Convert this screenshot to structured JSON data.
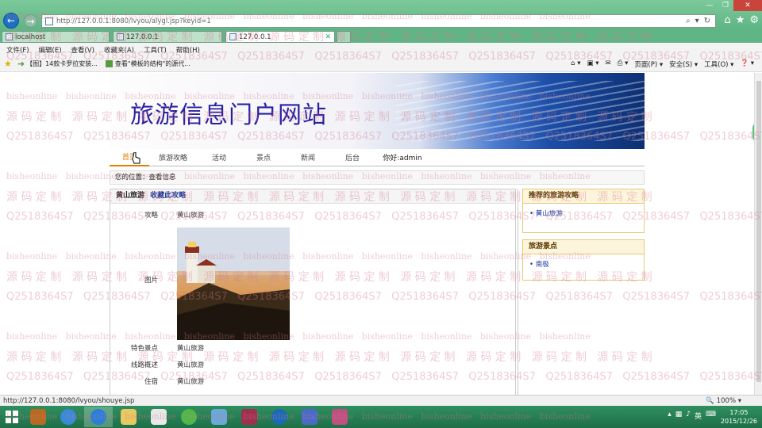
{
  "browser": {
    "address_url": "http://127.0.0.1:8080/lvyou/alygl.jsp?keyid=1",
    "tabs": [
      {
        "label": "localhost"
      },
      {
        "label": "127.0.0.1"
      },
      {
        "label": "127.0.0.1"
      }
    ],
    "menu": [
      "文件(F)",
      "编辑(E)",
      "查看(V)",
      "收藏夹(A)",
      "工具(T)",
      "帮助(H)"
    ],
    "favorites": [
      {
        "label": "【图】14款卡罗拉安装..."
      },
      {
        "label": "查看\"模板的结构\"的源代..."
      }
    ],
    "commands": [
      "页面(P) ▾",
      "安全(S) ▾",
      "工具(O) ▾",
      "❓ ▾"
    ],
    "status_url": "http://127.0.0.1:8080/lvyou/shouye.jsp",
    "zoom": "100%"
  },
  "site": {
    "banner_title": "旅游信息门户网站",
    "nav": [
      {
        "label": "首页"
      },
      {
        "label": "旅游攻略"
      },
      {
        "label": "活动"
      },
      {
        "label": "景点"
      },
      {
        "label": "新闻"
      },
      {
        "label": "后台"
      }
    ],
    "greeting": "你好:admin",
    "breadcrumb": "您的位置：查看信息",
    "main": {
      "title": "黄山旅游",
      "favorite_link": "收藏此攻略",
      "fields": {
        "gonglue_label": "攻略",
        "gonglue_value": "黄山旅游",
        "picture_label": "图片",
        "tese_label": "特色景点",
        "tese_value": "黄山旅游",
        "xianlu_label": "线路概述",
        "xianlu_value": "黄山旅游",
        "zhusu_label": "住宿",
        "zhusu_value": "黄山旅游"
      }
    },
    "sidebar": {
      "recommend_title": "推荐的旅游攻略",
      "recommend_items": [
        "黄山旅游"
      ],
      "spots_title": "旅游景点",
      "spots_items": [
        "南极"
      ]
    }
  },
  "watermark": {
    "line_a": "bisheonline",
    "line_b": "源 码 定 制",
    "line_c": "Q2518364S7"
  },
  "taskbar": {
    "time": "17:05",
    "date": "2015/12/26"
  }
}
